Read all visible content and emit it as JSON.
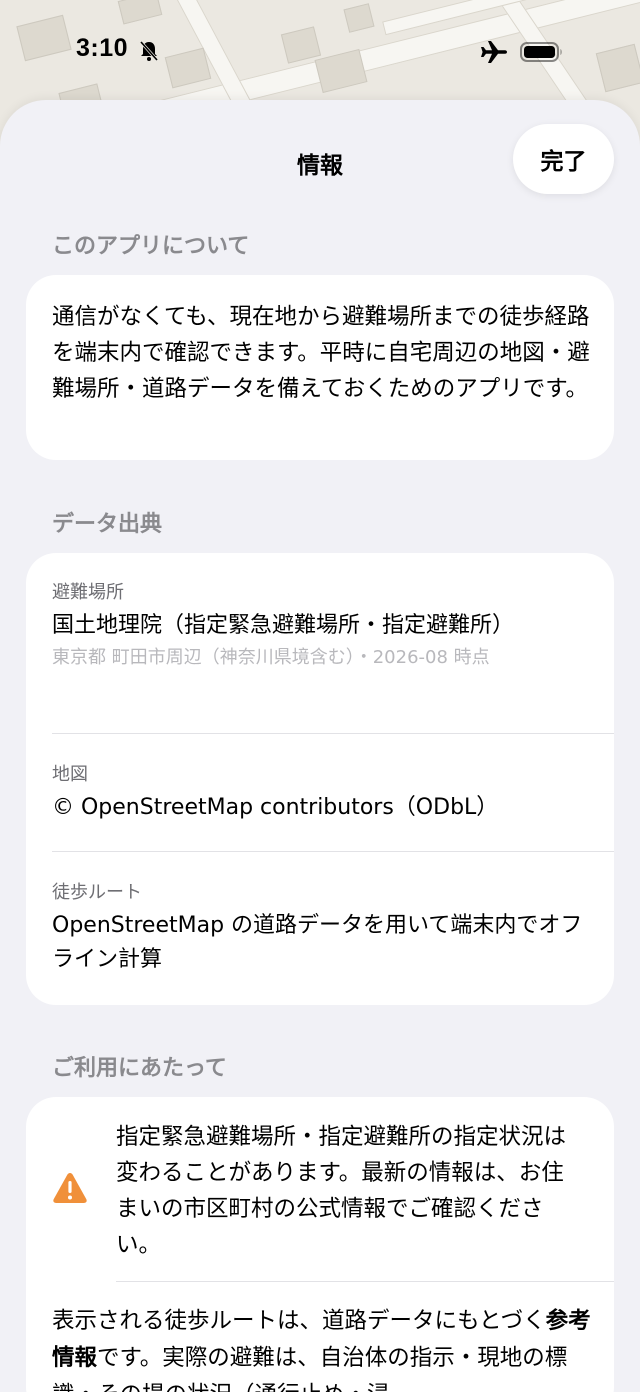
{
  "status_bar": {
    "time": "3:10",
    "icons": [
      "bell-slash-icon",
      "airplane-icon",
      "battery-icon"
    ]
  },
  "sheet": {
    "title": "情報",
    "done_label": "完了"
  },
  "about": {
    "header": "このアプリについて",
    "text": "通信がなくても、現在地から避難場所までの徒歩経路を端末内で確認できます。平時に自宅周辺の地図・避難場所・道路データを備えておくためのアプリです。"
  },
  "sources": {
    "header": "データ出典",
    "items": [
      {
        "label": "避難場所",
        "value": "国土地理院（指定緊急避難場所・指定避難所）",
        "note": "東京都 町田市周辺（神奈川県境含む）・2026-08 時点"
      },
      {
        "label": "地図",
        "value": "© OpenStreetMap contributors（ODbL）"
      },
      {
        "label": "徒歩ルート",
        "value": "OpenStreetMap の道路データを用いて端末内でオフライン計算"
      }
    ]
  },
  "usage": {
    "header": "ご利用にあたって",
    "warning": "指定緊急避難場所・指定避難所の指定状況は変わることがあります。最新の情報は、お住まいの市区町村の公式情報でご確認ください。",
    "note_part1": "表示される徒歩ルートは、道路データにもとづく",
    "note_bold": "参考情報",
    "note_part2": "です。実際の避難は、自治体の指示・現地の標識・その場の状況（通行止め・浸"
  },
  "colors": {
    "sheet_bg": "#f1f1f6",
    "card_bg": "#ffffff",
    "section_header": "#8a8a8e",
    "warning": "#f0903a"
  }
}
